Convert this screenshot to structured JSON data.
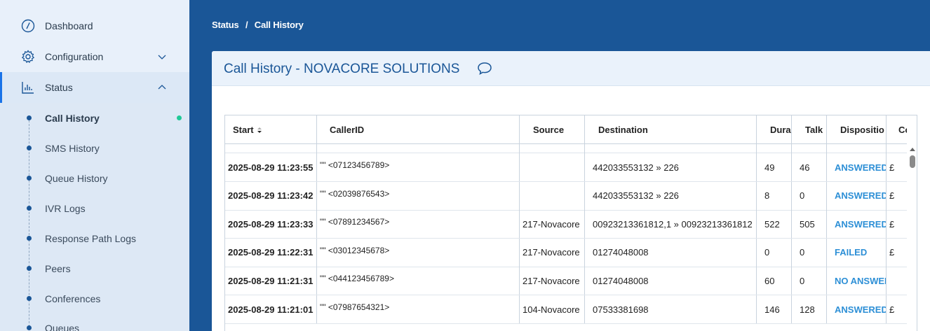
{
  "sidebar": {
    "items": [
      {
        "label": "Dashboard",
        "icon": "dashboard-icon"
      },
      {
        "label": "Configuration",
        "icon": "gear-icon"
      },
      {
        "label": "Status",
        "icon": "chart-icon"
      }
    ],
    "submenu": [
      {
        "label": "Call History"
      },
      {
        "label": "SMS History"
      },
      {
        "label": "Queue History"
      },
      {
        "label": "IVR Logs"
      },
      {
        "label": "Response Path Logs"
      },
      {
        "label": "Peers"
      },
      {
        "label": "Conferences"
      },
      {
        "label": "Queues"
      }
    ]
  },
  "breadcrumb": {
    "parent": "Status",
    "separator": "/",
    "current": "Call History"
  },
  "card": {
    "title": "Call History - NOVACORE SOLUTIONS"
  },
  "table": {
    "columns": [
      "Start",
      "CallerID",
      "Source",
      "Destination",
      "Dura",
      "Talk",
      "Dispositio",
      "Cost"
    ],
    "rows": [
      {
        "start": "2025-08-29 11:23:55",
        "callerid": "\"\" <07123456789>",
        "source": "",
        "destination": "442033553132 » 226",
        "duration": "49",
        "talk": "46",
        "disposition": "ANSWERED",
        "cost": "£"
      },
      {
        "start": "2025-08-29 11:23:42",
        "callerid": "\"\" <02039876543>",
        "source": "",
        "destination": "442033553132 » 226",
        "duration": "8",
        "talk": "0",
        "disposition": "ANSWERED",
        "cost": "£"
      },
      {
        "start": "2025-08-29 11:23:33",
        "callerid": "\"\" <07891234567>",
        "source": "217-Novacore",
        "destination": "00923213361812,1 » 00923213361812",
        "duration": "522",
        "talk": "505",
        "disposition": "ANSWERED",
        "cost": "£"
      },
      {
        "start": "2025-08-29 11:22:31",
        "callerid": "\"\" <03012345678>",
        "source": "217-Novacore",
        "destination": "01274048008",
        "duration": "0",
        "talk": "0",
        "disposition": "FAILED",
        "cost": "£"
      },
      {
        "start": "2025-08-29 11:21:31",
        "callerid": "\"\" <044123456789>",
        "source": "217-Novacore",
        "destination": "01274048008",
        "duration": "60",
        "talk": "0",
        "disposition": "NO ANSWER",
        "cost": ""
      },
      {
        "start": "2025-08-29 11:21:01",
        "callerid": "\"\" <07987654321>",
        "source": "104-Novacore",
        "destination": "07533381698",
        "duration": "146",
        "talk": "128",
        "disposition": "ANSWERED",
        "cost": "£"
      }
    ]
  },
  "colors": {
    "header_bg": "#1a5697",
    "sidebar_bg": "#e8f0fa",
    "accent": "#2d8fd6",
    "active_dot": "#20c997"
  }
}
